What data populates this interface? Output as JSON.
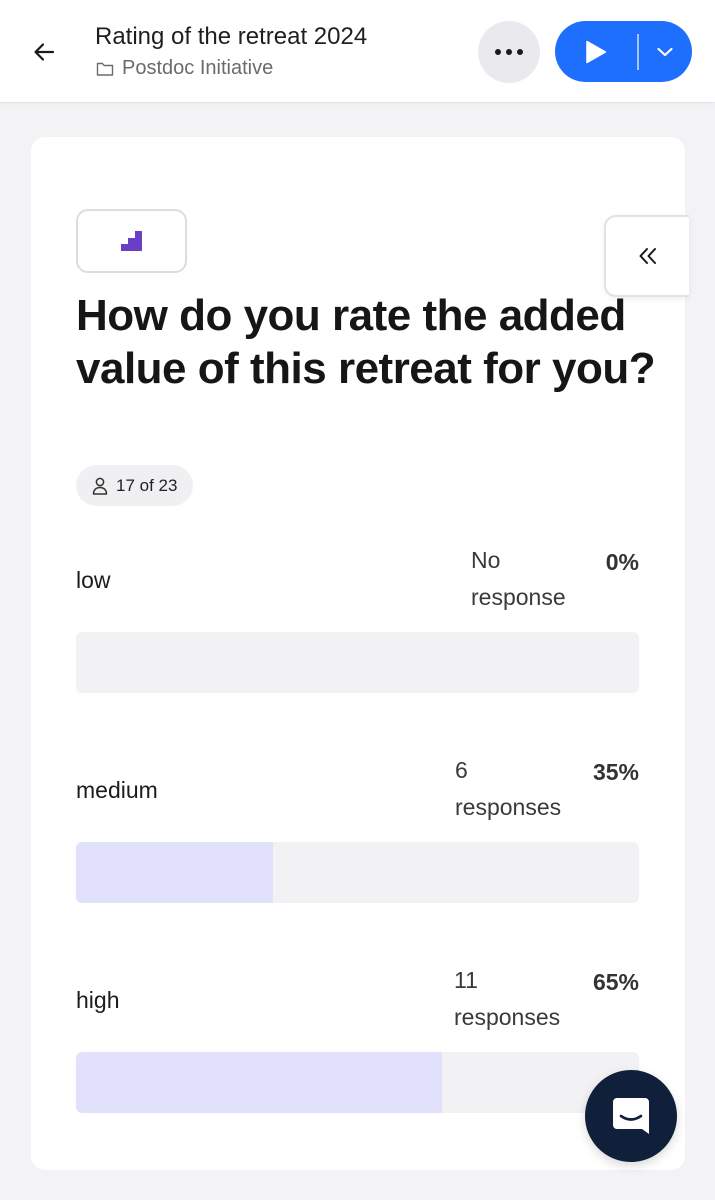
{
  "header": {
    "title": "Rating of the retreat 2024",
    "folder": "Postdoc Initiative",
    "icons": {
      "back": "arrow-left-icon",
      "folder": "folder-icon",
      "more": "more-dots-icon",
      "present": "play-icon",
      "present_menu": "chevron-down-icon"
    },
    "accent_color": "#1f6fff"
  },
  "card": {
    "type_icon": "scales-bar-icon",
    "collapse_icon": "double-chevron-left-icon",
    "question": "How do you rate the added value of this retreat for you?",
    "respondents": "17 of 23",
    "options": [
      {
        "label": "low",
        "count_line1": "No",
        "count_line2": "response",
        "percent": "0%",
        "fraction": 0.0
      },
      {
        "label": "medium",
        "count_line1": "6",
        "count_line2": "responses",
        "percent": "35%",
        "fraction": 0.35
      },
      {
        "label": "high",
        "count_line1": "11",
        "count_line2": "responses",
        "percent": "65%",
        "fraction": 0.65
      }
    ],
    "bar_fill_color": "#e1e1fb"
  },
  "chat": {
    "icon": "chat-bubble-icon"
  }
}
